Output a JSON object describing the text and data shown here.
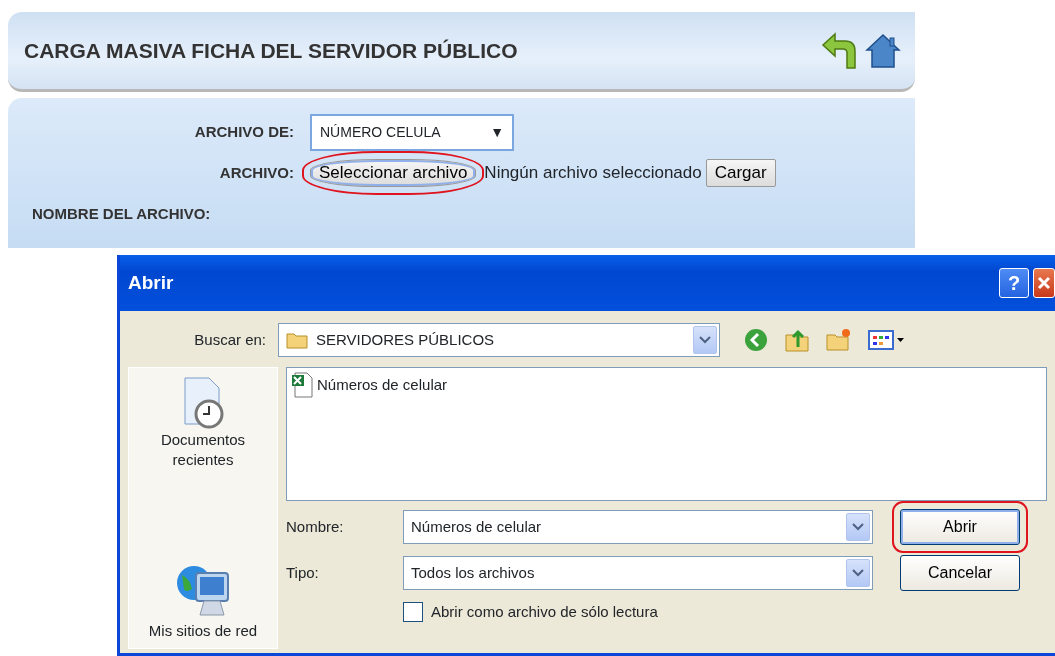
{
  "page": {
    "title": "CARGA MASIVA FICHA DEL SERVIDOR PÚBLICO",
    "form": {
      "archivo_de_label": "ARCHIVO DE:",
      "archivo_de_value": "NÚMERO CELULA",
      "archivo_de_caret": "▼",
      "archivo_label": "ARCHIVO:",
      "select_button": {
        "label": "Seleccionar archivo",
        "highlighted": true
      },
      "file_status": "Ningún archivo seleccionado",
      "upload_button": "Cargar",
      "nombre_label": "NOMBRE DEL ARCHIVO:"
    }
  },
  "dialog": {
    "title": "Abrir",
    "help_button": "?",
    "look_in_label": "Buscar en:",
    "look_in_value": "SERVIDORES PÚBLICOS",
    "places": [
      {
        "kind": "recent",
        "label": "Documentos recientes"
      },
      {
        "kind": "network",
        "label": "Mis sitios de red"
      }
    ],
    "files": [
      {
        "name": "Números de celular",
        "selected": false
      }
    ],
    "name_label": "Nombre:",
    "name_value": "Números de celular",
    "type_label": "Tipo:",
    "type_value": "Todos los archivos",
    "readonly": {
      "label": "Abrir como archivo de sólo lectura",
      "checked": false
    },
    "buttons": [
      {
        "label": "Abrir",
        "highlighted": true
      },
      {
        "label": "Cancelar",
        "highlighted": false
      }
    ]
  }
}
